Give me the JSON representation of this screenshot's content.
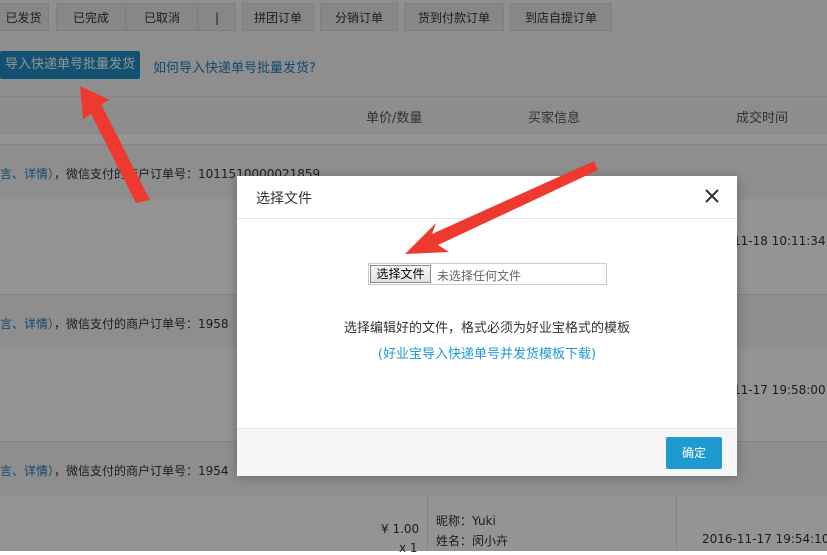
{
  "tabs": [
    "已发货",
    "已完成",
    "已取消",
    "|",
    "拼团订单",
    "分销订单",
    "货到付款订单",
    "到店自提订单"
  ],
  "toolbar": {
    "import_label": "导入快递单号批量发货",
    "help_link": "如何导入快递单号批量发货?"
  },
  "table_header": {
    "price_qty": "单价/数量",
    "buyer": "买家信息",
    "deal_time": "成交时间"
  },
  "orders": [
    {
      "link": "言、详情）",
      "merchant_label": "，微信支付的商户订单号：1011510000021859",
      "time": "11-18 10:11:34"
    },
    {
      "link": "言、详情）",
      "merchant_label": "，微信支付的商户订单号：1958",
      "time": "11-17 19:58:00"
    },
    {
      "link": "言、详情）",
      "merchant_label": "，微信支付的商户订单号：1954",
      "price": "¥ 1.00",
      "qty": "x 1",
      "nickname": "昵称：Yuki",
      "name": "姓名：闵小卉",
      "time": "2016-11-17 19:54:10"
    }
  ],
  "modal": {
    "title": "选择文件",
    "file_button": "选择文件",
    "file_status": "未选择任何文件",
    "hint": "选择编辑好的文件，格式必须为好业宝格式的模板",
    "template_link": "(好业宝导入快递单号并发货模板下载)",
    "confirm": "确定"
  }
}
